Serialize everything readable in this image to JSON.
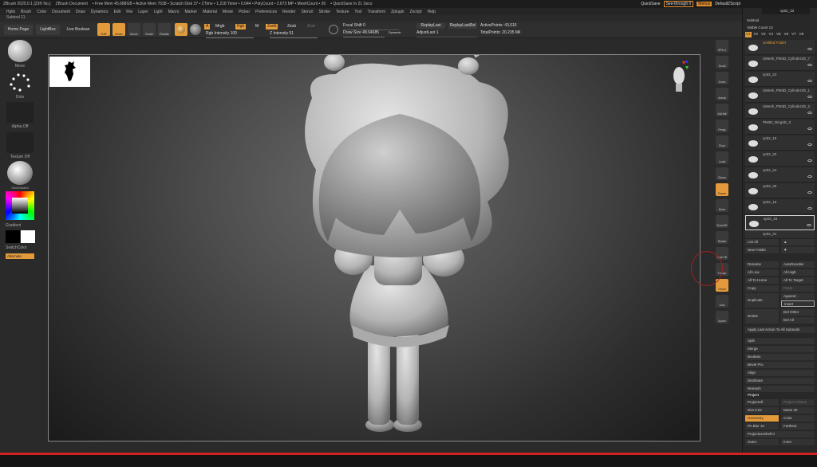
{
  "titlebar": {
    "items": [
      "ZBrush 2025.0.1 [23® No.]",
      "ZBrush Document",
      "• Free Mem 45.688GB • Active Mem 7538 • Scratch Disk 37 • ZTime • 1.218 Timer • 0.044 • PolyCount • 3.673 MP • MeshCount • 26",
      "• QuickSave In 21 Secs"
    ],
    "quicksave": "QuickSave",
    "seethrough": "See-through 0",
    "menus": "Menus",
    "script": "DefaultZScript"
  },
  "menubar": [
    "Hplix",
    "Brush",
    "Color",
    "Document",
    "Draw",
    "Dynamics",
    "Edit",
    "File",
    "Layer",
    "Light",
    "Macro",
    "Marker",
    "Material",
    "Movie",
    "Picker",
    "Preferences",
    "Render",
    "Stencil",
    "Stroke",
    "Texture",
    "Tool",
    "Transform",
    "Zplugin",
    "Zscript",
    "Help"
  ],
  "subtool_label": "Subtool 11",
  "toolbar": {
    "home": "Home Page",
    "lightbox": "LightBox",
    "liveboolean": "Live Boolean",
    "edit": "Edit",
    "draw": "Draw",
    "move": "Move",
    "scale": "Scale",
    "rotate": "Rotate",
    "a": "A",
    "mrgb": "Mrgb",
    "rgb": "Rgb",
    "m": "M",
    "zadd": "Zadd",
    "zsub": "Zsub",
    "zcut": "Zcut",
    "rgb_intensity": "Rgb Intensity 100",
    "z_intensity": "Z Intensity 51",
    "focal_shift": "Focal Shift 0",
    "draw_size": "Draw Size 48.64685",
    "dynamic": "Dynamic",
    "replaylast": "ReplayLast",
    "replaylastrel": "ReplayLastRel",
    "adjustlast": "AdjustLast 1",
    "activepoints": "ActivePoints: 43,016",
    "totalpoints": "TotalPoints: 20.235 Mil"
  },
  "leftpanel": {
    "move": "Move",
    "dots": "Dots",
    "alpha": "Alpha Off",
    "texture": "Texture Off",
    "material": "SkinShade4",
    "gradient": "Gradient",
    "switchcolor": "SwitchColor",
    "alternate": "Alternate"
  },
  "righttools": [
    "SPix 3",
    "Scroll",
    "Zoom",
    "Actual",
    "AAHalf",
    "Persp",
    "Floor",
    "Local",
    "Gizmo",
    "Frame",
    "Move",
    "Zoom3D",
    "Rotate",
    "Line Fill",
    "Transp",
    "Ghost",
    "Solo",
    "Xpose"
  ],
  "rightpanel": {
    "subtool": "Subtool",
    "visible_count": "Visible Count 13",
    "vtabs": [
      "V1",
      "V2",
      "V3",
      "V4",
      "V5",
      "V6",
      "V7",
      "V8"
    ],
    "items": [
      "Untitled Folder",
      "UMesh_PM3D_Cylinder3D_7",
      "xp02_23",
      "UMesh_PM3D_Cylinder3D_1",
      "UMesh_PM3D_Cylinder3D_2",
      "PM3D_Ring3D_3",
      "xp02_19",
      "xp02_20",
      "xp02_24",
      "xp02_30",
      "xp02_18",
      "xp02_33",
      "xp02_31"
    ],
    "listall": "List All",
    "newfolder": "New Folder",
    "rename": "Rename",
    "autoreorder": "AutoReorder",
    "alllow": "All Low",
    "allhigh": "All High",
    "alltohome": "All To Home",
    "alltotarget": "All To Target",
    "copy": "Copy",
    "paste": "Paste",
    "duplicate": "Duplicate",
    "append": "Append",
    "insert": "Insert",
    "delete": "Delete",
    "delother": "Del Other",
    "delall": "Del All",
    "applylast": "Apply Last Action To All Subtools",
    "split": "Split",
    "merge": "Merge",
    "boolean": "Boolean",
    "bevelpro": "Bevel Pro",
    "align": "Align",
    "distribute": "Distribute",
    "remesh": "Remesh",
    "project": "Project",
    "projectall": "ProjectAll",
    "projecthistory": "Project History",
    "dist": "Dist 0.02",
    "mean": "Mean 25",
    "geometry": "Geometry",
    "color": "Color",
    "pablur": "PA Blur 10",
    "farthest": "Farthest",
    "projectionshell": "ProjectionShell 0",
    "outer": "Outer",
    "inner": "Inner",
    "search": "xp02_33"
  }
}
